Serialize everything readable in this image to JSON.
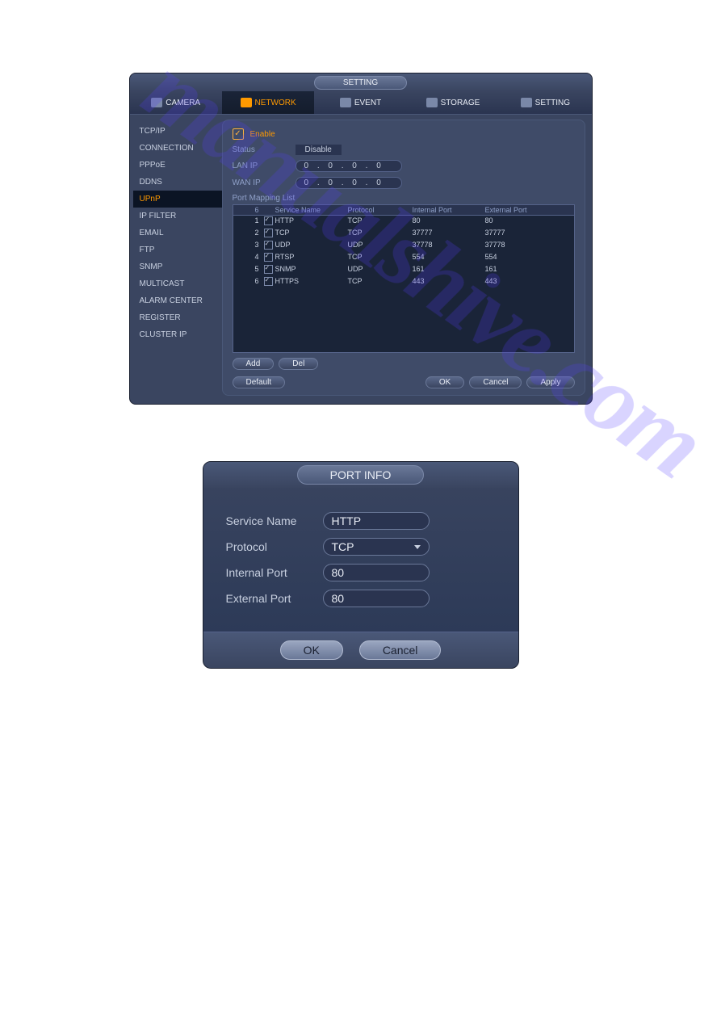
{
  "main": {
    "title": "SETTING",
    "tabs": [
      {
        "label": "CAMERA"
      },
      {
        "label": "NETWORK"
      },
      {
        "label": "EVENT"
      },
      {
        "label": "STORAGE"
      },
      {
        "label": "SETTING"
      }
    ],
    "sidebar": [
      "TCP/IP",
      "CONNECTION",
      "PPPoE",
      "DDNS",
      "UPnP",
      "IP FILTER",
      "EMAIL",
      "FTP",
      "SNMP",
      "MULTICAST",
      "ALARM CENTER",
      "REGISTER",
      "CLUSTER IP"
    ],
    "sidebar_active": 4,
    "enable_label": "Enable",
    "status_label": "Status",
    "status_value": "Disable",
    "lanip_label": "LAN IP",
    "lanip_value": "0   .   0   .   0   .   0",
    "wanip_label": "WAN IP",
    "wanip_value": "0   .   0   .   0   .   0",
    "maplist_label": "Port Mapping List",
    "thead": {
      "count": "6",
      "svc": "Service Name",
      "proto": "Protocol",
      "int": "Internal Port",
      "ext": "External Port"
    },
    "rows": [
      {
        "n": "1",
        "svc": "HTTP",
        "proto": "TCP",
        "int": "80",
        "ext": "80"
      },
      {
        "n": "2",
        "svc": "TCP",
        "proto": "TCP",
        "int": "37777",
        "ext": "37777"
      },
      {
        "n": "3",
        "svc": "UDP",
        "proto": "UDP",
        "int": "37778",
        "ext": "37778"
      },
      {
        "n": "4",
        "svc": "RTSP",
        "proto": "TCP",
        "int": "554",
        "ext": "554"
      },
      {
        "n": "5",
        "svc": "SNMP",
        "proto": "UDP",
        "int": "161",
        "ext": "161"
      },
      {
        "n": "6",
        "svc": "HTTPS",
        "proto": "TCP",
        "int": "443",
        "ext": "443"
      }
    ],
    "buttons": {
      "add": "Add",
      "del": "Del",
      "default": "Default",
      "ok": "OK",
      "cancel": "Cancel",
      "apply": "Apply"
    }
  },
  "dialog": {
    "title": "PORT INFO",
    "service_label": "Service Name",
    "service_value": "HTTP",
    "protocol_label": "Protocol",
    "protocol_value": "TCP",
    "intport_label": "Internal Port",
    "intport_value": "80",
    "extport_label": "External Port",
    "extport_value": "80",
    "ok": "OK",
    "cancel": "Cancel"
  },
  "watermark": "manualshive.com"
}
